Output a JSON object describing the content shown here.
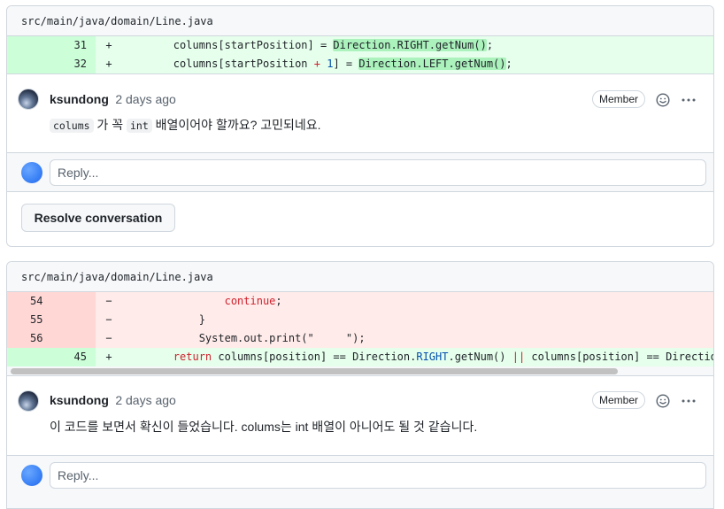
{
  "threads": [
    {
      "file_path": "src/main/java/domain/Line.java",
      "diff_lines": [
        {
          "num": "31",
          "sign": "+",
          "indent": "        ",
          "pre": "columns[startPosition] = ",
          "hl": "Direction.RIGHT.getNum()",
          "post": ";"
        },
        {
          "num": "32",
          "sign": "+",
          "indent": "        ",
          "pre": "columns[startPosition ",
          "op": "+",
          "one": " 1",
          "mid": "] = ",
          "hl": "Direction.LEFT.getNum()",
          "post": ";"
        }
      ],
      "comment": {
        "author": "ksundong",
        "time": "2 days ago",
        "badge": "Member",
        "code1": "colums",
        "text1": " 가 꼭 ",
        "code2": "int",
        "text2": " 배열이어야 할까요? 고민되네요."
      },
      "reply_placeholder": "Reply...",
      "resolve_label": "Resolve conversation"
    },
    {
      "file_path": "src/main/java/domain/Line.java",
      "del_lines": [
        {
          "num": "54",
          "sign": "−",
          "indent": "                ",
          "kw": "continue",
          "post": ";"
        },
        {
          "num": "55",
          "sign": "−",
          "indent": "            ",
          "text": "}"
        },
        {
          "num": "56",
          "sign": "−",
          "indent": "            ",
          "text": "System.out.print(\"     \");"
        }
      ],
      "add_line": {
        "num": "45",
        "sign": "+",
        "indent": "        ",
        "kw": "return",
        "pre": " columns[position] == Direction.",
        "blue": "RIGHT",
        "mid": ".getNum() ",
        "op": "||",
        "post": " columns[position] == Direction"
      },
      "comment": {
        "author": "ksundong",
        "time": "2 days ago",
        "badge": "Member",
        "text": "이 코드를 보면서 확신이 들었습니다. colums는 int 배열이 아니어도 될 것 같습니다."
      },
      "reply_placeholder": "Reply..."
    }
  ],
  "icons": {
    "emoji": "smiley-icon",
    "more": "kebab-horizontal-icon"
  }
}
